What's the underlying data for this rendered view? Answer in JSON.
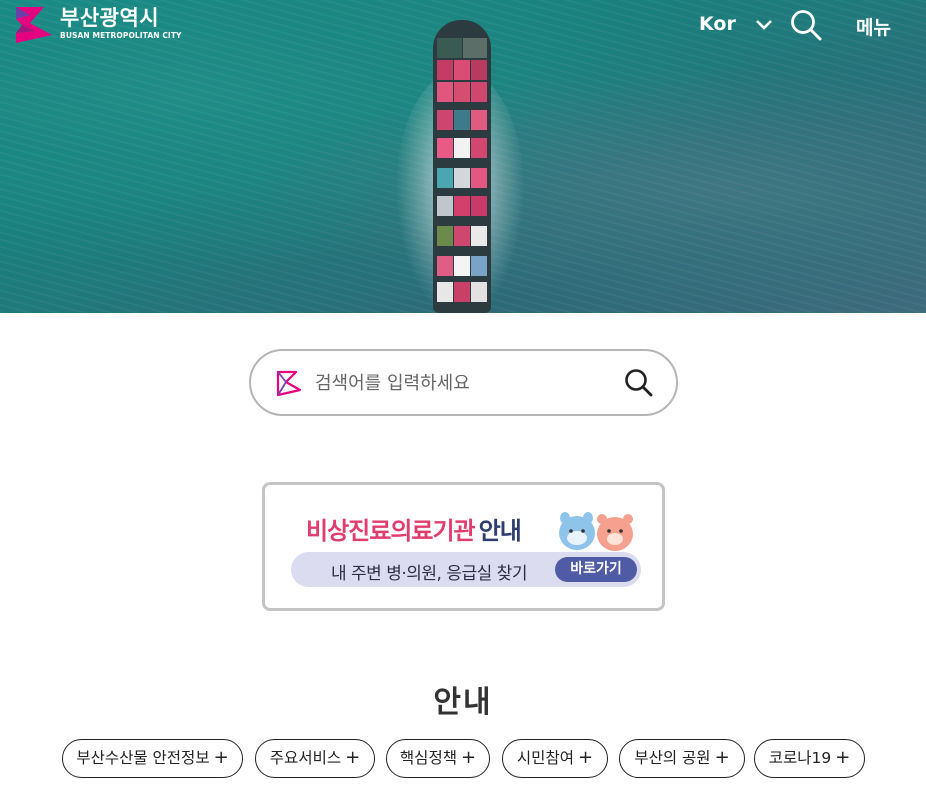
{
  "header": {
    "logo_title": "부산광역시",
    "logo_subtitle": "BUSAN METROPOLITAN CITY",
    "language": "Kor",
    "menu_label": "메뉴"
  },
  "icons": {
    "logo": "busan-logo-icon",
    "language_toggle": "chevron-down-icon",
    "header_search": "search-icon",
    "search_field_logo": "busan-logo-icon",
    "search_submit": "search-icon"
  },
  "search": {
    "placeholder": "검색어를 입력하세요"
  },
  "banner": {
    "title_highlight": "비상진료의료기관",
    "title_rest": "안내",
    "subtitle": "내 주변 병·의원, 응급실 찾기",
    "button_label": "바로가기"
  },
  "info": {
    "title": "안내",
    "chips": [
      {
        "label": "부산수산물 안전정보"
      },
      {
        "label": "주요서비스"
      },
      {
        "label": "핵심정책"
      },
      {
        "label": "시민참여"
      },
      {
        "label": "부산의 공원"
      },
      {
        "label": "코로나19"
      }
    ],
    "plus_symbol": "+"
  },
  "colors": {
    "brand_pink": "#e4007f",
    "banner_pink": "#e03d6f",
    "banner_navy": "#2e3d6e",
    "banner_button": "#4f5ba5",
    "sea": "#1b7e7c"
  }
}
